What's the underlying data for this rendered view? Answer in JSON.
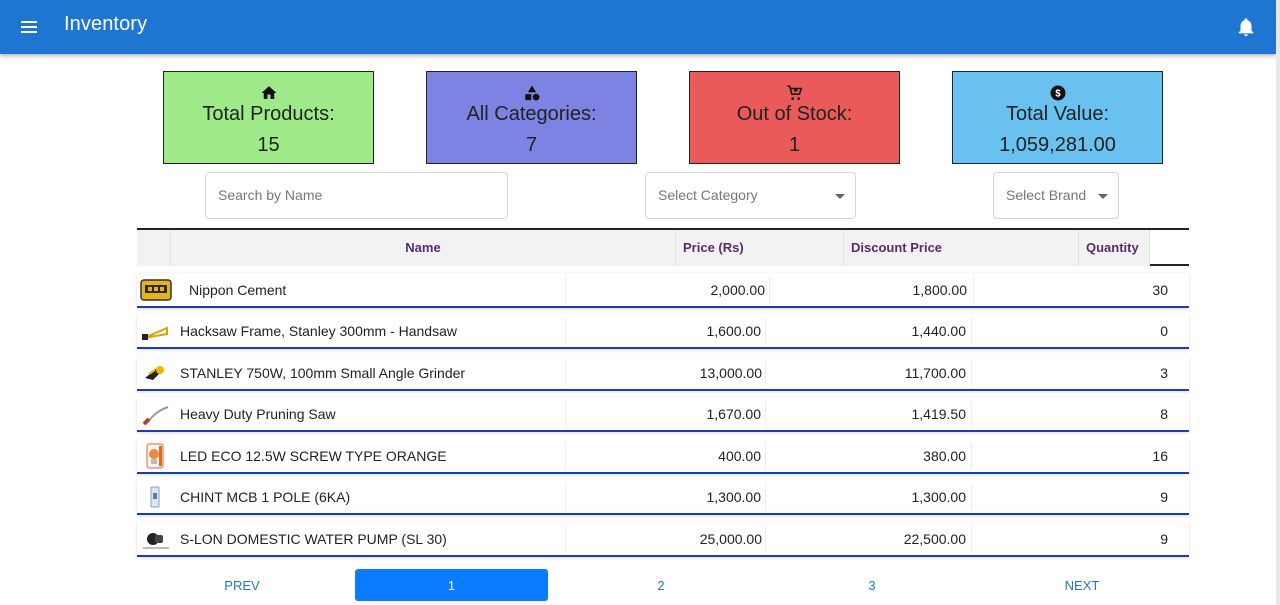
{
  "appbar": {
    "title": "Inventory",
    "menu_icon": "menu-icon",
    "notification_icon": "bell-icon",
    "color": "#1e76d2"
  },
  "summary": [
    {
      "icon": "home-icon",
      "label": "Total Products:",
      "value": "15",
      "color": "#9eea88"
    },
    {
      "icon": "shapes-icon",
      "label": "All Categories:",
      "value": "7",
      "color": "#7c83e2"
    },
    {
      "icon": "cart-remove-icon",
      "label": "Out of Stock:",
      "value": "1",
      "color": "#ea5a5a"
    },
    {
      "icon": "dollar-coin-icon",
      "label": "Total Value:",
      "value": "1,059,281.00",
      "color": "#68c1ee"
    }
  ],
  "filters": {
    "search_placeholder": "Search by Name",
    "search_value": "",
    "category_placeholder": "Select Category",
    "brand_placeholder": "Select Brand"
  },
  "table": {
    "columns": [
      "",
      "Name",
      "Price (Rs)",
      "Discount Price",
      "Quantity"
    ],
    "rows": [
      {
        "thumb": "cement-bag-thumb",
        "name": "Nippon Cement",
        "price": "2,000.00",
        "discount": "1,800.00",
        "qty": "30"
      },
      {
        "thumb": "hacksaw-thumb",
        "name": "Hacksaw Frame, Stanley 300mm - Handsaw",
        "price": "1,600.00",
        "discount": "1,440.00",
        "qty": "0"
      },
      {
        "thumb": "angle-grinder-thumb",
        "name": "STANLEY 750W, 100mm Small Angle Grinder",
        "price": "13,000.00",
        "discount": "11,700.00",
        "qty": "3"
      },
      {
        "thumb": "pruning-saw-thumb",
        "name": "Heavy Duty Pruning Saw",
        "price": "1,670.00",
        "discount": "1,419.50",
        "qty": "8"
      },
      {
        "thumb": "led-bulb-thumb",
        "name": "LED ECO 12.5W SCREW TYPE ORANGE",
        "price": "400.00",
        "discount": "380.00",
        "qty": "16"
      },
      {
        "thumb": "mcb-thumb",
        "name": "CHINT MCB 1 POLE (6KA)",
        "price": "1,300.00",
        "discount": "1,300.00",
        "qty": "9"
      },
      {
        "thumb": "water-pump-thumb",
        "name": "S-LON DOMESTIC WATER PUMP (SL 30)",
        "price": "25,000.00",
        "discount": "22,500.00",
        "qty": "9"
      }
    ]
  },
  "pagination": {
    "prev": "PREV",
    "pages": [
      "1",
      "2",
      "3"
    ],
    "current": "1",
    "next": "NEXT"
  }
}
